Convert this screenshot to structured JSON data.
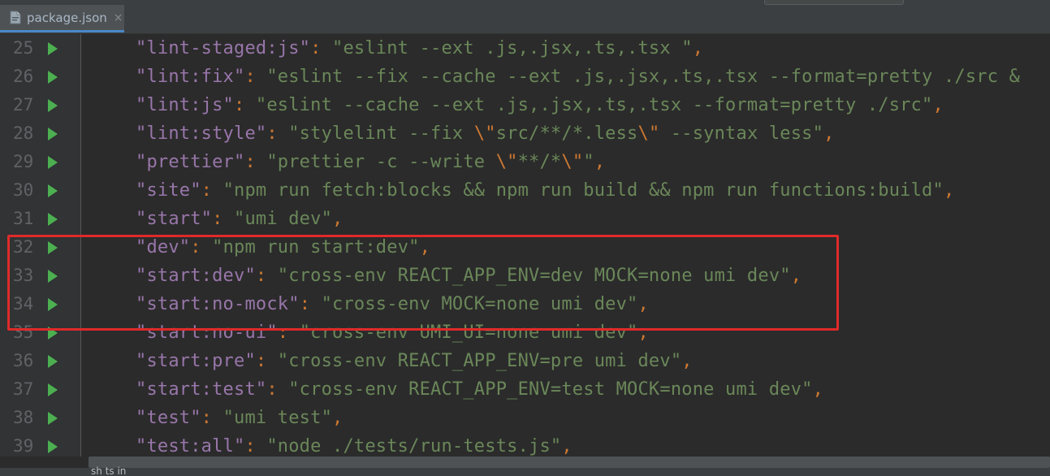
{
  "tab": {
    "label": "package.json",
    "close": "×",
    "icon": "json-file-icon"
  },
  "editor": {
    "lines": [
      {
        "num": "25",
        "key": "\"lint-staged:js\"",
        "value": "\"eslint --ext .js,.jsx,.ts,.tsx \""
      },
      {
        "num": "26",
        "key": "\"lint:fix\"",
        "value": "\"eslint --fix --cache --ext .js,.jsx,.ts,.tsx --format=pretty ./src &"
      },
      {
        "num": "27",
        "key": "\"lint:js\"",
        "value": "\"eslint --cache --ext .js,.jsx,.ts,.tsx --format=pretty ./src\""
      },
      {
        "num": "28",
        "key": "\"lint:style\"",
        "value_parts": [
          "\"stylelint --fix ",
          "\\\"",
          "src/**/*.less",
          "\\\"",
          " --syntax less\""
        ]
      },
      {
        "num": "29",
        "key": "\"prettier\"",
        "value_parts": [
          "\"prettier -c --write ",
          "\\\"",
          "**/*",
          "\\\"",
          "\""
        ]
      },
      {
        "num": "30",
        "key": "\"site\"",
        "value": "\"npm run fetch:blocks && npm run build && npm run functions:build\""
      },
      {
        "num": "31",
        "key": "\"start\"",
        "value": "\"umi dev\""
      },
      {
        "num": "32",
        "key": "\"dev\"",
        "value": "\"npm run start:dev\""
      },
      {
        "num": "33",
        "key": "\"start:dev\"",
        "value": "\"cross-env REACT_APP_ENV=dev MOCK=none umi dev\""
      },
      {
        "num": "34",
        "key": "\"start:no-mock\"",
        "value": "\"cross-env MOCK=none umi dev\""
      },
      {
        "num": "35",
        "key": "\"start:no-ui\"",
        "value": "\"cross-env UMI_UI=none umi dev\""
      },
      {
        "num": "36",
        "key": "\"start:pre\"",
        "value": "\"cross-env REACT_APP_ENV=pre umi dev\""
      },
      {
        "num": "37",
        "key": "\"start:test\"",
        "value": "\"cross-env REACT_APP_ENV=test MOCK=none umi dev\""
      },
      {
        "num": "38",
        "key": "\"test\"",
        "value": "\"umi test\""
      },
      {
        "num": "39",
        "key": "\"test:all\"",
        "value": "\"node ./tests/run-tests.js\""
      }
    ],
    "colon": ": ",
    "comma": ","
  },
  "status": {
    "fragment": "sh ts  in"
  },
  "colors": {
    "key": "#9876aa",
    "string": "#6a8759",
    "punctuation": "#cc7832",
    "highlight": "#e02a2a",
    "run": "#4caf50"
  }
}
